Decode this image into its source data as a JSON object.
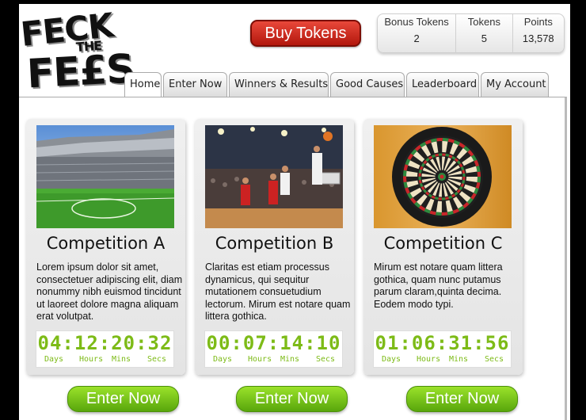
{
  "logo": {
    "line1": "FECK",
    "line2": "THE",
    "line3": "FE£S"
  },
  "header": {
    "buy_label": "Buy Tokens"
  },
  "stats": [
    {
      "label": "Bonus Tokens",
      "value": "2"
    },
    {
      "label": "Tokens",
      "value": "5"
    },
    {
      "label": "Points",
      "value": "13,578"
    }
  ],
  "tabs": [
    {
      "label": "Home"
    },
    {
      "label": "Enter Now"
    },
    {
      "label": "Winners & Results"
    },
    {
      "label": "Good Causes"
    },
    {
      "label": "Leaderboard"
    },
    {
      "label": "My Account"
    }
  ],
  "competitions": [
    {
      "title": "Competition A",
      "image": "football-stadium",
      "text": "Lorem ipsum dolor sit amet, consectetuer adipiscing elit, diam nonummy nibh euismod tincidunt ut laoreet dolore magna aliquam erat volutpat.",
      "timer": "04:12:20:32",
      "button": "Enter Now"
    },
    {
      "title": "Competition B",
      "image": "basketball-game",
      "text": "Claritas est etiam processus dynamicus, qui sequitur mutationem consuetudium lectorum. Mirum est notare quam littera gothica.",
      "timer": "00:07:14:10",
      "button": "Enter Now"
    },
    {
      "title": "Competition C",
      "image": "dartboard",
      "text": "Mirum est notare quam littera gothica, quam nunc putamus parum claram,quinta decima. Eodem modo typi.",
      "timer": "01:06:31:56",
      "button": "Enter Now"
    }
  ],
  "timer_units": {
    "days": "Days",
    "hours": "Hours",
    "mins": "Mins",
    "secs": "Secs"
  }
}
